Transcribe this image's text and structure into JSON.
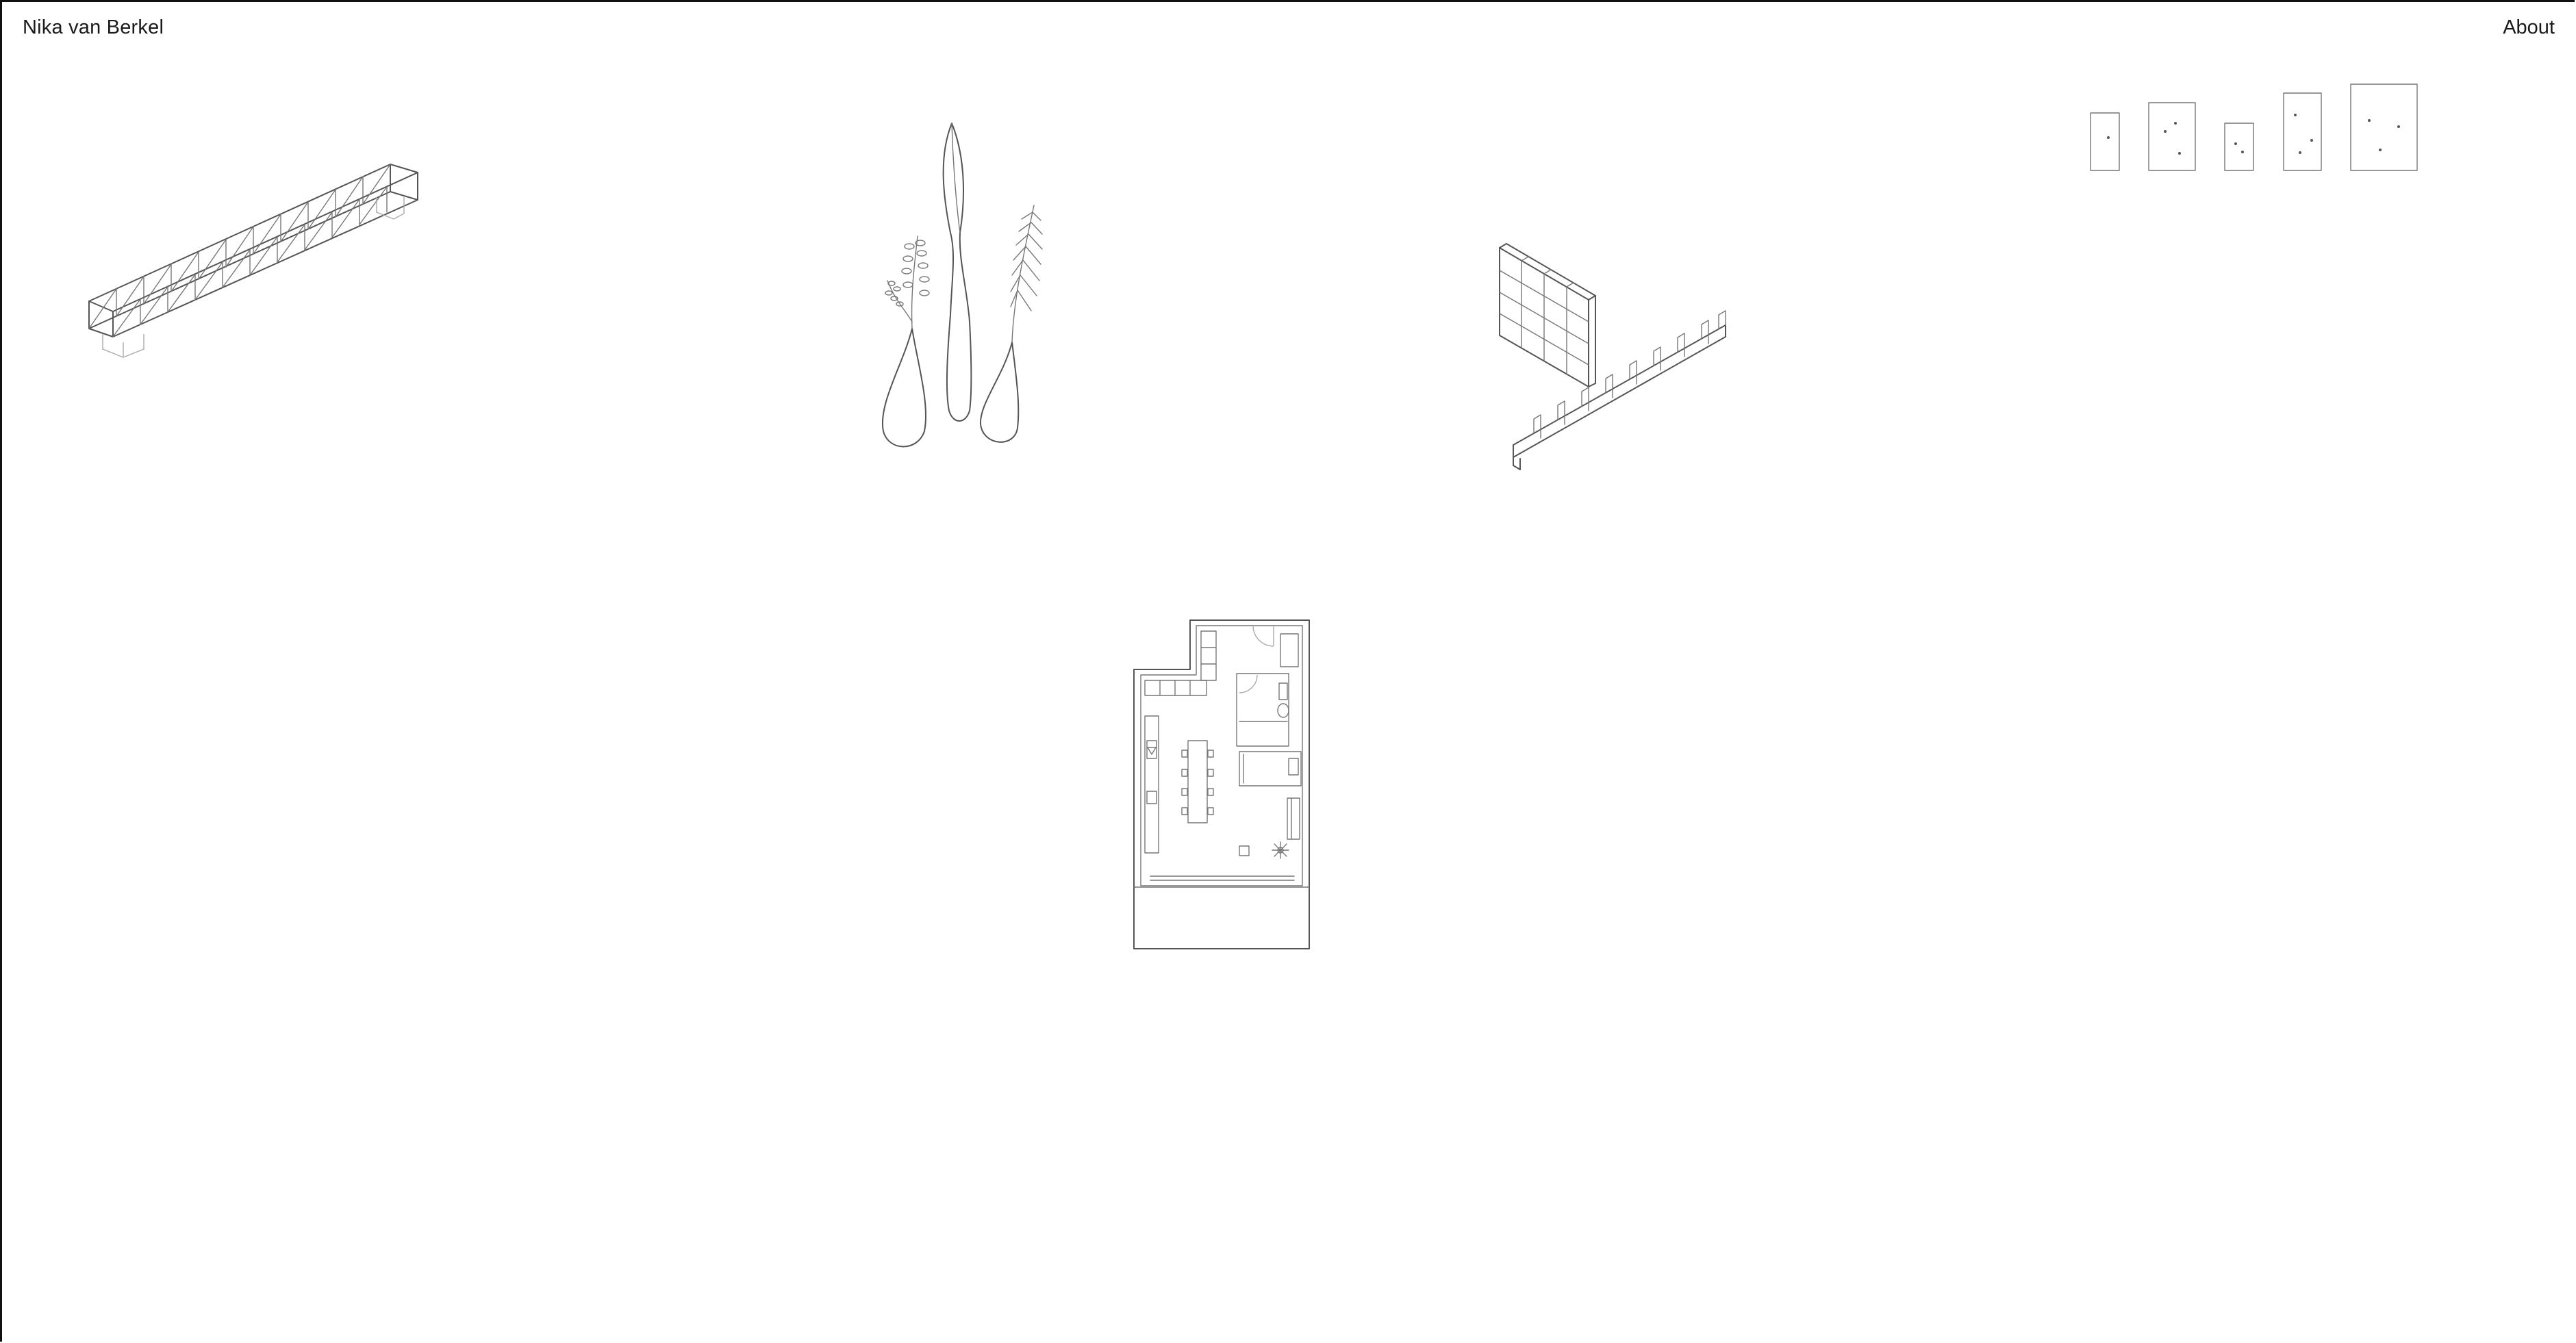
{
  "header": {
    "site_title": "Nika van Berkel",
    "about_label": "About"
  },
  "projects": [
    {
      "icon": "bridge-truss-icon"
    },
    {
      "icon": "plant-vases-icon"
    },
    {
      "icon": "shelving-system-icon"
    },
    {
      "icon": "dotted-frames-icon"
    },
    {
      "icon": "floor-plan-icon"
    }
  ]
}
